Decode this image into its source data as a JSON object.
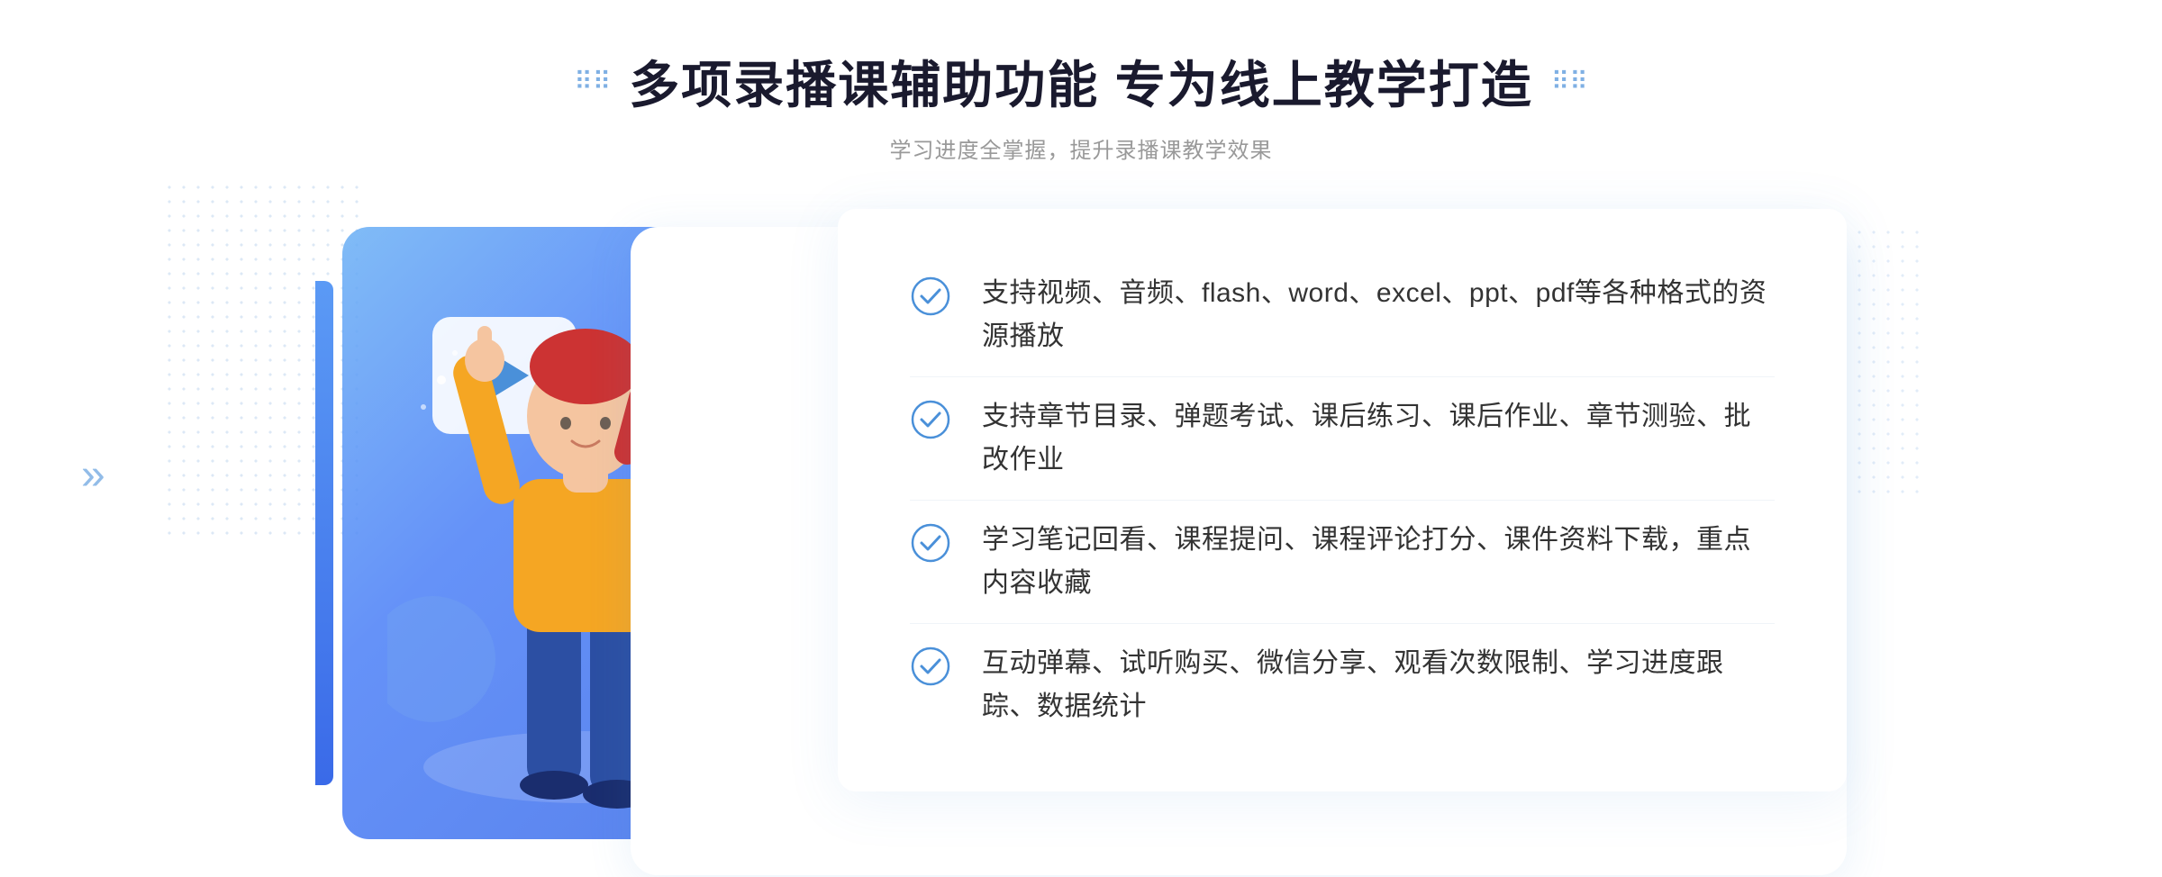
{
  "page": {
    "title": "多项录播课辅助功能 专为线上教学打造",
    "subtitle": "学习进度全掌握，提升录播课教学效果"
  },
  "features": [
    {
      "id": "feature-1",
      "text": "支持视频、音频、flash、word、excel、ppt、pdf等各种格式的资源播放"
    },
    {
      "id": "feature-2",
      "text": "支持章节目录、弹题考试、课后练习、课后作业、章节测验、批改作业"
    },
    {
      "id": "feature-3",
      "text": "学习笔记回看、课程提问、课程评论打分、课件资料下载，重点内容收藏"
    },
    {
      "id": "feature-4",
      "text": "互动弹幕、试听购买、微信分享、观看次数限制、学习进度跟踪、数据统计"
    }
  ],
  "decorations": {
    "chevron_symbol": "»",
    "dots_symbol": "⠿⠿"
  },
  "colors": {
    "primary_blue": "#4a90d9",
    "dark_text": "#1a1a2e",
    "subtitle_gray": "#999999",
    "feature_text": "#333333"
  }
}
